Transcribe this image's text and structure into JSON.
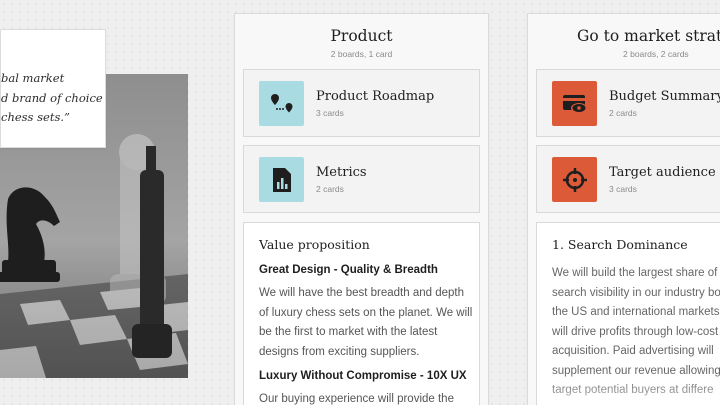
{
  "quote": {
    "lines": [
      "bal market",
      "d brand of choice",
      "chess sets.”"
    ]
  },
  "columns": [
    {
      "title": "Product",
      "subtitle": "2 boards, 1 card",
      "boards": [
        {
          "title": "Product Roadmap",
          "count": "3 cards",
          "icon": "roadmap-pins-icon",
          "color": "#a9dbe3"
        },
        {
          "title": "Metrics",
          "count": "2 cards",
          "icon": "metrics-chart-icon",
          "color": "#a9dbe3"
        }
      ],
      "card": {
        "heading": "Value proposition",
        "sections": [
          {
            "subheading": "Great Design - Quality & Breadth",
            "lines": [
              "We will have the best breadth and depth",
              "of luxury chess sets on the planet. We will",
              "be the first to market with the latest",
              "designs from exciting suppliers."
            ]
          },
          {
            "subheading": "Luxury Without Compromise - 10X UX",
            "lines": [
              "Our buying experience will provide the"
            ]
          }
        ]
      }
    },
    {
      "title": "Go to market strateg",
      "subtitle": "2 boards, 2 cards",
      "boards": [
        {
          "title": "Budget Summary",
          "count": "2 cards",
          "icon": "budget-card-eye-icon",
          "color": "#dc5a37"
        },
        {
          "title": "Target audience",
          "count": "3 cards",
          "icon": "target-crosshair-icon",
          "color": "#dc5a37"
        }
      ],
      "card": {
        "heading": "1. Search Dominance",
        "lines": [
          "We will build the largest share of o",
          "search visibility in our industry bo",
          "the US and international markets.",
          "will drive profits through low-cost",
          "acquisition. Paid advertising will",
          "supplement our revenue allowing",
          "target potential buyers at differe"
        ]
      }
    }
  ]
}
